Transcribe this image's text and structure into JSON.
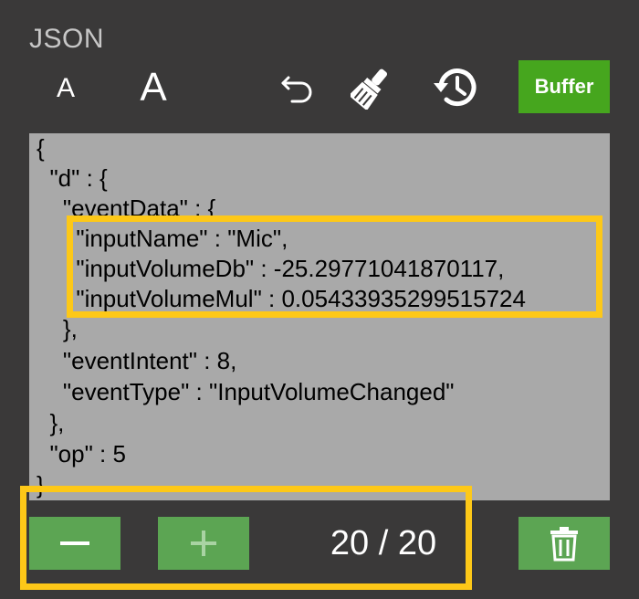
{
  "header": {
    "title": "JSON",
    "font_small_label": "A",
    "font_large_label": "A",
    "buffer_label": "Buffer"
  },
  "editor": {
    "lines": [
      "{",
      "  \"d\" : {",
      "    \"eventData\" : {",
      "      \"inputName\" : \"Mic\",",
      "      \"inputVolumeDb\" : -25.29771041870117,",
      "      \"inputVolumeMul\" : 0.05433935299515724",
      "    },",
      "    \"eventIntent\" : 8,",
      "    \"eventType\" : \"InputVolumeChanged\"",
      "  },",
      "  \"op\" : 5",
      "}"
    ]
  },
  "footer": {
    "counter": "20 / 20"
  },
  "colors": {
    "background": "#3a3939",
    "editor_bg": "#a9a9a9",
    "buffer_green": "#46a61e",
    "button_green": "#5ca553",
    "highlight": "#fdc818"
  }
}
